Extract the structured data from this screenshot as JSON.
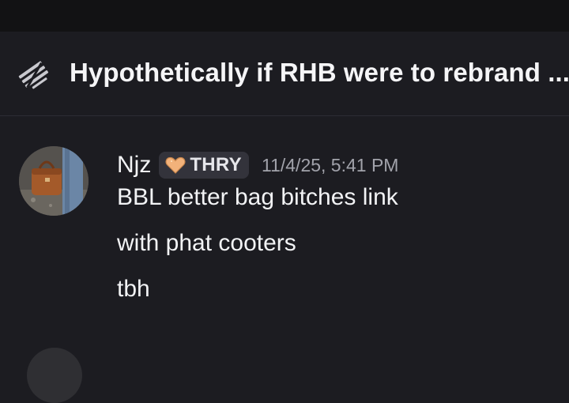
{
  "thread": {
    "title": "Hypothetically if RHB were to rebrand ...",
    "icon": "thread-icon"
  },
  "message": {
    "author": "Njz",
    "tag": {
      "icon": "heart-icon",
      "label": "THRY",
      "icon_color": "#f2b27a"
    },
    "timestamp": "11/4/25, 5:41 PM",
    "lines": [
      "BBL better bag bitches link",
      "with phat cooters",
      "tbh"
    ]
  },
  "colors": {
    "background": "#1c1c21",
    "top_bar": "#121214",
    "muted_text": "#a2a3ab",
    "text": "#f2f3f5"
  }
}
